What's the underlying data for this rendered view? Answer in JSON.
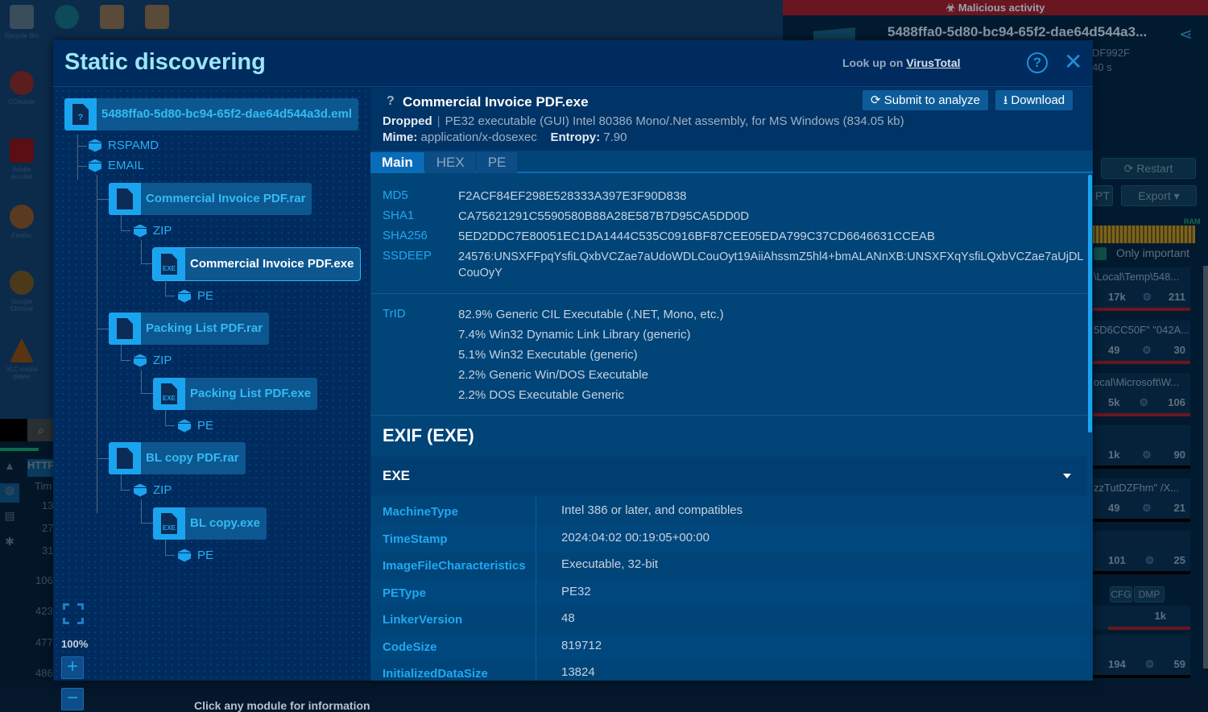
{
  "desktop": {
    "icons": [
      {
        "label": "Recycle Bin",
        "icon": "recycle-bin-icon"
      },
      {
        "label": "Microsoft Edge",
        "icon": "edge-icon"
      },
      {
        "label": "",
        "icon": "word-doc-icon"
      },
      {
        "label": "",
        "icon": "word-doc-icon"
      },
      {
        "label": "CCleaner",
        "icon": "ccleaner-icon"
      },
      {
        "label": "Adobe Acrobat",
        "icon": "acrobat-icon"
      },
      {
        "label": "Firefox",
        "icon": "firefox-icon"
      },
      {
        "label": "Google Chrome",
        "icon": "chrome-icon"
      },
      {
        "label": "VLC media player",
        "icon": "vlc-icon"
      }
    ]
  },
  "background_app": {
    "banner": "Malicious activity",
    "task_title": "5488ffa0-5d80-bc94-65f2-dae64d544a3...",
    "hash_fragment": "DF992F",
    "time_fragment": "40 s",
    "restart_label": "Restart",
    "export_label": "Export",
    "pt_label": "PT",
    "ram_label": "RAM",
    "only_important_label": "Only important",
    "only_important_checked": true,
    "process_cards": [
      {
        "path": "\\Local\\Temp\\548...",
        "a": "17k",
        "b": "211"
      },
      {
        "path": "5D6CC50F\" \"042A...",
        "a": "49",
        "b": "30"
      },
      {
        "path": "ocal\\Microsoft\\W...",
        "a": "5k",
        "b": "106"
      },
      {
        "path": "",
        "a": "1k",
        "b": "90"
      },
      {
        "path": "zzTutDZFhm\" /X...",
        "a": "49",
        "b": "21"
      },
      {
        "path": "",
        "a": "101",
        "b": "25"
      },
      {
        "path": "",
        "a": "1k",
        "b": ""
      },
      {
        "path": "",
        "a": "194",
        "b": "59"
      }
    ],
    "tags": [
      "CFG",
      "DMP"
    ],
    "left_panel": {
      "tab": "HTTP",
      "col": "Tim",
      "rows": [
        "13",
        "27",
        "31",
        "106",
        "423",
        "477",
        "486"
      ]
    }
  },
  "modal": {
    "title": "Static discovering",
    "lookup_prefix": "Look up on",
    "lookup_link": "VirusTotal",
    "tree": {
      "root": "5488ffa0-5d80-bc94-65f2-dae64d544a3d.eml",
      "modules_root": [
        "RSPAMD",
        "EMAIL"
      ],
      "archives": [
        {
          "name": "Commercial Invoice PDF.rar",
          "module": "ZIP",
          "exe": "Commercial Invoice PDF.exe",
          "exe_module": "PE",
          "selected": true
        },
        {
          "name": "Packing List PDF.rar",
          "module": "ZIP",
          "exe": "Packing List PDF.exe",
          "exe_module": "PE",
          "selected": false
        },
        {
          "name": "BL copy PDF.rar",
          "module": "ZIP",
          "exe": "BL copy.exe",
          "exe_module": "PE",
          "selected": false
        }
      ],
      "exe_badge": "EXE",
      "unknown_badge": "?",
      "zoom_level": "100%",
      "hint": "Click any module for information"
    },
    "detail": {
      "qmark": "?",
      "filename": "Commercial Invoice PDF.exe",
      "submit_label": "Submit to analyze",
      "download_label": "Download",
      "dropped_label": "Dropped",
      "filetype": "PE32 executable (GUI) Intel 80386 Mono/.Net assembly, for MS Windows (834.05 kb)",
      "mime_label": "Mime:",
      "mime": "application/x-dosexec",
      "entropy_label": "Entropy:",
      "entropy": "7.90",
      "tabs": [
        "Main",
        "HEX",
        "PE"
      ],
      "active_tab": "Main",
      "hashes": [
        {
          "k": "MD5",
          "v": "F2ACF84EF298E528333A397E3F90D838"
        },
        {
          "k": "SHA1",
          "v": "CA75621291C5590580B88A28E587B7D95CA5DD0D"
        },
        {
          "k": "SHA256",
          "v": "5ED2DDC7E80051EC1DA1444C535C0916BF87CEE05EDA799C37CD6646631CCEAB"
        },
        {
          "k": "SSDEEP",
          "v": "24576:UNSXFFpqYsfiLQxbVCZae7aUdoWDLCouOyt19AiiAhssmZ5hl4+bmALANnXB:UNSXFXqYsfiLQxbVCZae7aUjDLCouOyY"
        }
      ],
      "trid_label": "TrID",
      "trid": [
        "82.9% Generic CIL Executable (.NET, Mono, etc.)",
        "7.4% Win32 Dynamic Link Library (generic)",
        "5.1% Win32 Executable (generic)",
        "2.2% Generic Win/DOS Executable",
        "2.2% DOS Executable Generic"
      ],
      "exif_title": "EXIF (EXE)",
      "exif_section": "EXE",
      "exif_rows": [
        {
          "k": "MachineType",
          "v": "Intel 386 or later, and compatibles"
        },
        {
          "k": "TimeStamp",
          "v": "2024:04:02 00:19:05+00:00"
        },
        {
          "k": "ImageFileCharacteristics",
          "v": "Executable, 32-bit"
        },
        {
          "k": "PEType",
          "v": "PE32"
        },
        {
          "k": "LinkerVersion",
          "v": "48"
        },
        {
          "k": "CodeSize",
          "v": "819712"
        },
        {
          "k": "InitializedDataSize",
          "v": "13824"
        }
      ]
    }
  }
}
